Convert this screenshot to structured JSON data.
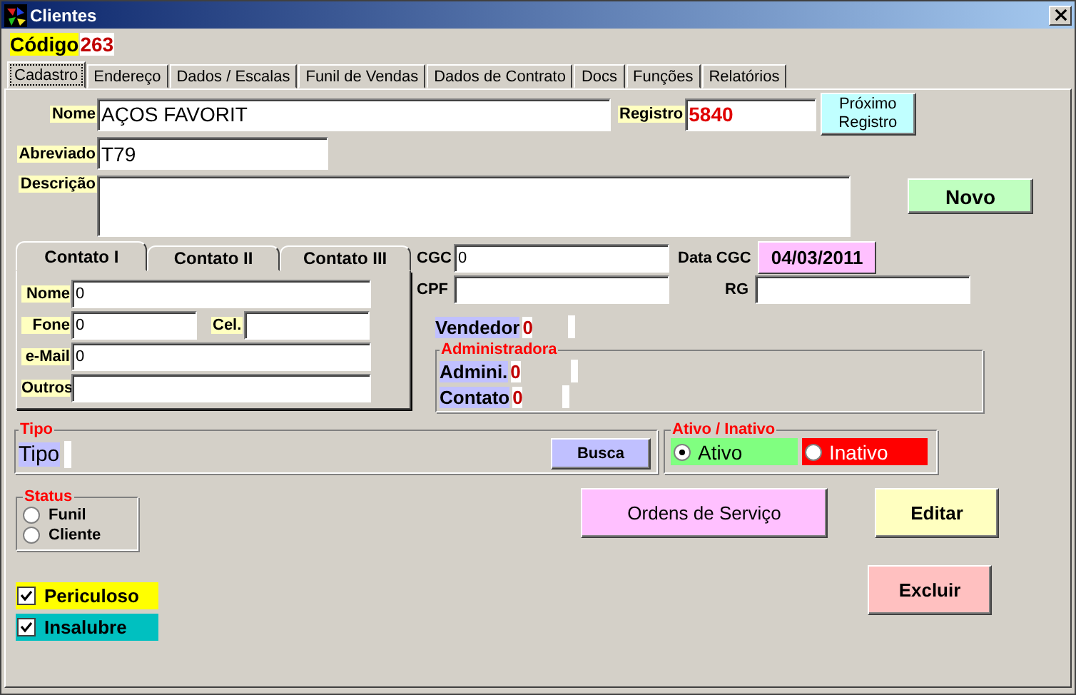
{
  "window": {
    "title": "Clientes"
  },
  "codigo": {
    "label": "Código",
    "value": "263"
  },
  "tabs": [
    {
      "label": "Cadastro",
      "selected": true
    },
    {
      "label": "Endereço",
      "selected": false
    },
    {
      "label": "Dados / Escalas",
      "selected": false
    },
    {
      "label": "Funil de Vendas",
      "selected": false
    },
    {
      "label": "Dados de Contrato",
      "selected": false
    },
    {
      "label": "Docs",
      "selected": false
    },
    {
      "label": "Funções",
      "selected": false
    },
    {
      "label": "Relatórios",
      "selected": false
    }
  ],
  "nome": {
    "label": "Nome",
    "value": "AÇOS FAVORIT"
  },
  "registro": {
    "label": "Registro",
    "value": "5840"
  },
  "next_button": "Próximo Registro",
  "abreviado": {
    "label": "Abreviado",
    "value": "T79"
  },
  "descricao": {
    "label": "Descrição"
  },
  "novo_button": "Novo",
  "contact_tabs": [
    {
      "label": "Contato I",
      "selected": true
    },
    {
      "label": "Contato II",
      "selected": false
    },
    {
      "label": "Contato III",
      "selected": false
    }
  ],
  "contact_fields": [
    {
      "label": "Nome",
      "value": "0"
    },
    {
      "label": "Fone",
      "value": "0"
    },
    {
      "label": "Cel."
    },
    {
      "label": "e-Mail",
      "value": "0"
    },
    {
      "label": "Outros"
    }
  ],
  "cgc": {
    "label": "CGC",
    "value": "0"
  },
  "data_cgc": {
    "label": "Data CGC",
    "value": "04/03/2011"
  },
  "cpf": {
    "label": "CPF"
  },
  "rg": {
    "label": "RG"
  },
  "vendedor": {
    "label": "Vendedor",
    "value": "0"
  },
  "administradora": {
    "title": "Administradora",
    "rows": [
      {
        "label": "Admini.",
        "value": "0"
      },
      {
        "label": "Contato",
        "value": "0"
      }
    ]
  },
  "tipo": {
    "title": "Tipo",
    "label": "Tipo",
    "button": "Busca"
  },
  "ativo": {
    "title": "Ativo / Inativo",
    "options": [
      {
        "label": "Ativo",
        "selected": true,
        "color": "#80ff80"
      },
      {
        "label": "Inativo",
        "selected": false,
        "color": "#ff0000"
      }
    ]
  },
  "status": {
    "title": "Status",
    "options": [
      {
        "label": "Funil",
        "selected": false
      },
      {
        "label": "Cliente",
        "selected": false
      }
    ]
  },
  "ordens_button": "Ordens de Serviço",
  "editar_button": "Editar",
  "excluir_button": "Excluir",
  "flags": [
    {
      "label": "Periculoso",
      "checked": true,
      "color": "#ffff00"
    },
    {
      "label": "Insalubre",
      "checked": true,
      "color": "#00c0c0"
    }
  ]
}
